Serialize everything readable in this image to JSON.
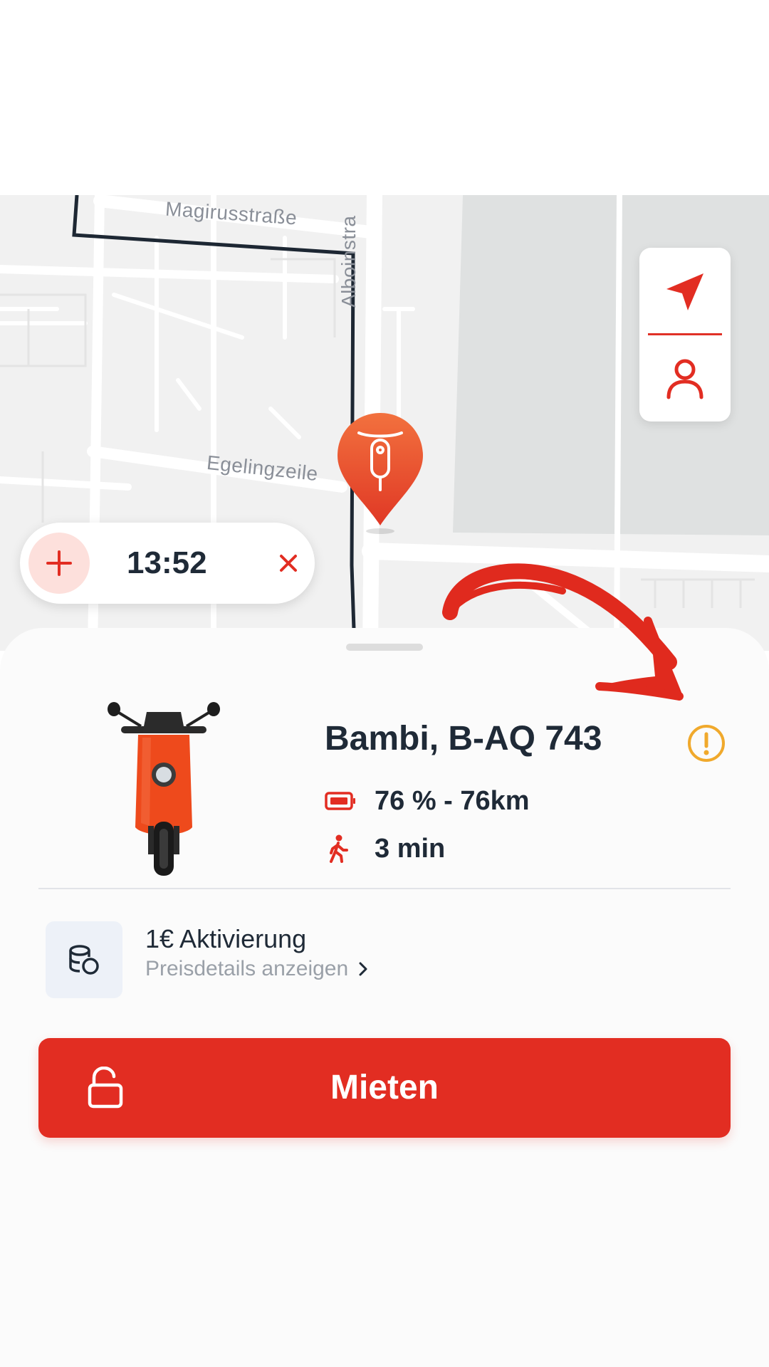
{
  "map": {
    "streets": [
      "Magirusstraße",
      "Alboinstra",
      "Egelingzeile"
    ]
  },
  "timer": {
    "value": "13:52"
  },
  "vehicle": {
    "name": "Bambi, B-AQ 743",
    "battery": "76 % - 76km",
    "walk_time": "3 min"
  },
  "pricing": {
    "title": "1€ Aktivierung",
    "link": "Preisdetails anzeigen"
  },
  "rent_button": {
    "label": "Mieten"
  },
  "colors": {
    "accent": "#e22d22",
    "pin": "#e84a2e",
    "warning": "#f0a92c",
    "text": "#1f2a37"
  },
  "icons": [
    "navigation-arrow-icon",
    "user-icon",
    "scooter-pin-icon",
    "plus-icon",
    "close-icon",
    "info-warning-icon",
    "battery-icon",
    "walking-icon",
    "coins-icon",
    "chevron-right-icon",
    "unlock-icon"
  ]
}
